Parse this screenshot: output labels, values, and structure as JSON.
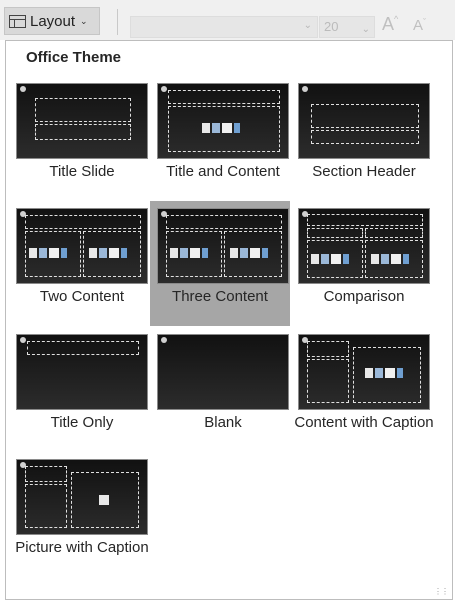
{
  "ribbon": {
    "layout_button_label": "Layout",
    "layout_icon": "layout-icon",
    "font_size_value": "20",
    "grow_font_glyph": "A",
    "shrink_font_glyph": "A"
  },
  "gallery": {
    "group_title": "Office Theme",
    "selected_index": 4,
    "items": [
      {
        "label": "Title Slide"
      },
      {
        "label": "Title and Content"
      },
      {
        "label": "Section Header"
      },
      {
        "label": "Two Content"
      },
      {
        "label": "Three Content"
      },
      {
        "label": "Comparison"
      },
      {
        "label": "Title Only"
      },
      {
        "label": "Blank"
      },
      {
        "label": "Content with Caption"
      },
      {
        "label": "Picture with Caption"
      }
    ]
  },
  "colors": {
    "selection": "#a6a6a6",
    "thumbnail_background": "#1a1a1a"
  }
}
